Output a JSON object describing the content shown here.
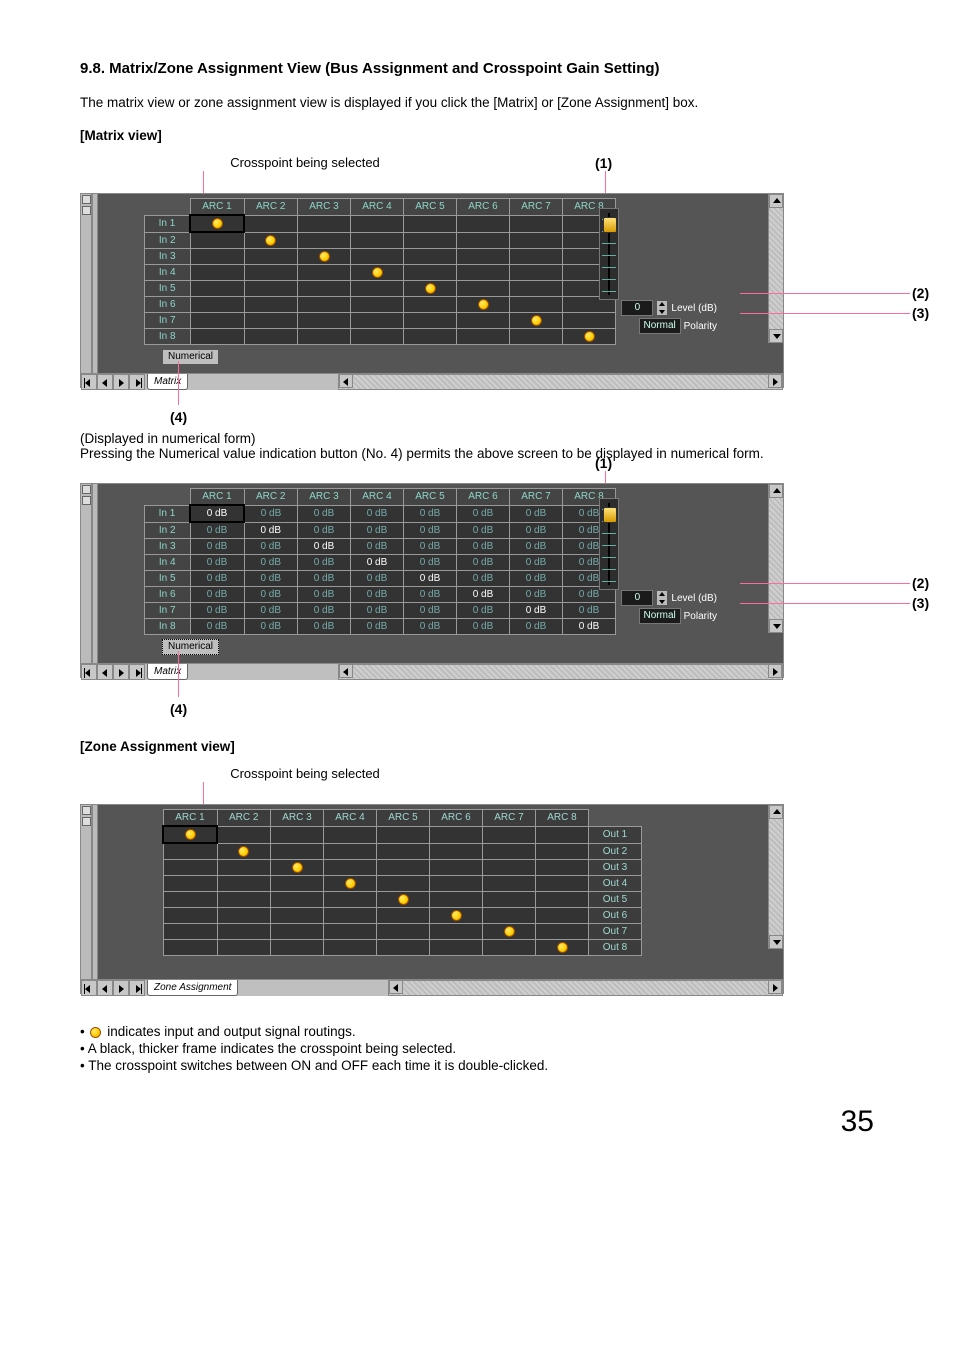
{
  "heading": "9.8. Matrix/Zone Assignment View (Bus Assignment and Crosspoint Gain Setting)",
  "intro": "The matrix view or zone assignment view is displayed if you click the [Matrix] or [Zone Assignment] box.",
  "matrixViewLabel": "[Matrix view]",
  "crosspointLabel": "Crosspoint being selected",
  "callouts": {
    "c1": "(1)",
    "c2": "(2)",
    "c3": "(3)",
    "c4": "(4)"
  },
  "columns": [
    "ARC 1",
    "ARC 2",
    "ARC 3",
    "ARC 4",
    "ARC 5",
    "ARC 6",
    "ARC 7",
    "ARC 8"
  ],
  "rows": [
    "In 1",
    "In 2",
    "In 3",
    "In 4",
    "In 5",
    "In 6",
    "In 7",
    "In 8"
  ],
  "numericalBtn": "Numerical",
  "tabMatrix": "Matrix",
  "tabZone": "Zone Assignment",
  "levelLabel": "Level (dB)",
  "levelValue": "0",
  "polarityLabel": "Polarity",
  "polarityValue": "Normal",
  "numericalDesc1": "(Displayed in numerical form)",
  "numericalDesc2": "Pressing the Numerical value indication button (No. 4) permits the above screen to be displayed in numerical form.",
  "dbActive": "0 dB",
  "dbInactive": "0 dB",
  "zoneViewLabel": "[Zone Assignment view]",
  "outLabels": [
    "Out 1",
    "Out 2",
    "Out 3",
    "Out 4",
    "Out 5",
    "Out 6",
    "Out 7",
    "Out 8"
  ],
  "bullets": {
    "b1a": " indicates input and output signal routings.",
    "b2": "A black, thicker frame indicates the crosspoint being selected.",
    "b3": "The crosspoint switches between ON and OFF each time it is double-clicked."
  },
  "pageNumber": "35"
}
